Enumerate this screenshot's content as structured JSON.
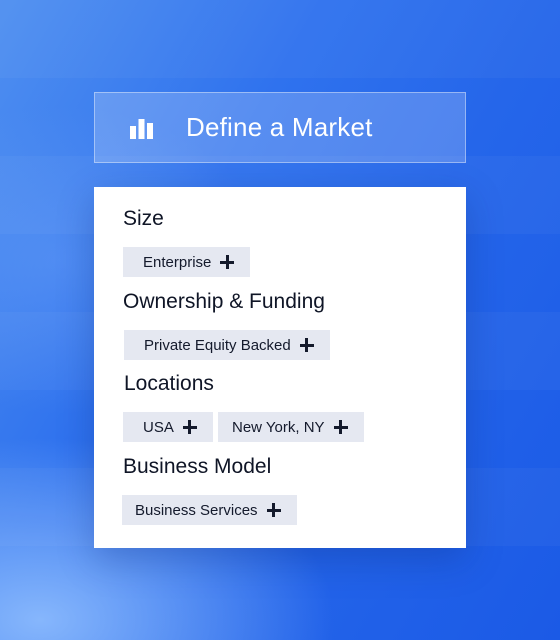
{
  "header": {
    "title": "Define a Market",
    "icon": "bar-chart-icon"
  },
  "sections": [
    {
      "label": "Size",
      "chips": [
        {
          "label": "Enterprise",
          "icon": "plus-icon"
        }
      ]
    },
    {
      "label": "Ownership & Funding",
      "chips": [
        {
          "label": "Private Equity Backed",
          "icon": "plus-icon"
        }
      ]
    },
    {
      "label": "Locations",
      "chips": [
        {
          "label": "USA",
          "icon": "plus-icon"
        },
        {
          "label": "New York, NY",
          "icon": "plus-icon"
        }
      ]
    },
    {
      "label": "Business Model",
      "chips": [
        {
          "label": "Business Services",
          "icon": "plus-icon"
        }
      ]
    }
  ],
  "colors": {
    "background": "#2566ea",
    "chip": "#e5e8f1",
    "text": "#0f1526"
  }
}
